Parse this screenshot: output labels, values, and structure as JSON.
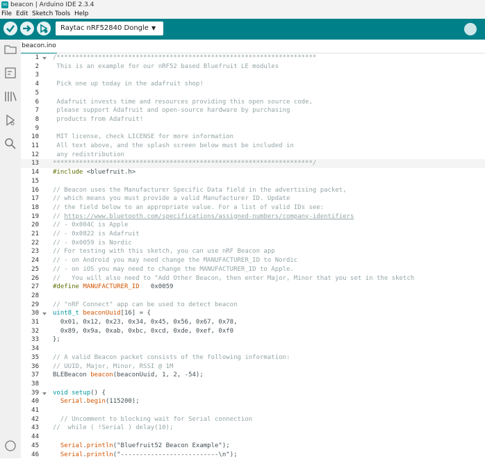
{
  "window": {
    "title": "beacon | Arduino IDE 2.3.4",
    "app_icon_text": "oo"
  },
  "menu": [
    "File",
    "Edit",
    "Sketch",
    "Tools",
    "Help"
  ],
  "toolbar": {
    "board": "Raytac nRF52840 Dongle"
  },
  "tab": {
    "label": "beacon.ino"
  },
  "colors": {
    "toolbar": "#00818a",
    "accent": "#00979d"
  },
  "code": {
    "current_line": 13,
    "lines": [
      {
        "n": "1",
        "parts": [
          {
            "t": "/*********************************************************************",
            "c": "cm"
          }
        ]
      },
      {
        "n": "2",
        "parts": [
          {
            "t": " This is an example for our nRF52 based Bluefruit LE modules",
            "c": "cm"
          }
        ]
      },
      {
        "n": "3",
        "parts": []
      },
      {
        "n": "4",
        "parts": [
          {
            "t": " Pick one up today in the adafruit shop!",
            "c": "cm"
          }
        ]
      },
      {
        "n": "5",
        "parts": []
      },
      {
        "n": "6",
        "parts": [
          {
            "t": " Adafruit invests time and resources providing this open source code,",
            "c": "cm"
          }
        ]
      },
      {
        "n": "7",
        "parts": [
          {
            "t": " please support Adafruit and open-source hardware by purchasing",
            "c": "cm"
          }
        ]
      },
      {
        "n": "8",
        "parts": [
          {
            "t": " products from Adafruit!",
            "c": "cm"
          }
        ]
      },
      {
        "n": "9",
        "parts": []
      },
      {
        "n": "10",
        "parts": [
          {
            "t": " MIT license, check LICENSE for more information",
            "c": "cm"
          }
        ]
      },
      {
        "n": "11",
        "parts": [
          {
            "t": " All text above, and the splash screen below must be included in",
            "c": "cm"
          }
        ]
      },
      {
        "n": "12",
        "parts": [
          {
            "t": " any redistribution",
            "c": "cm"
          }
        ]
      },
      {
        "n": "13",
        "parts": [
          {
            "t": "*********************************************************************/",
            "c": "cm"
          }
        ]
      },
      {
        "n": "14",
        "parts": [
          {
            "t": "#include ",
            "c": "pp"
          },
          {
            "t": "<bluefruit.h>",
            "c": ""
          }
        ]
      },
      {
        "n": "15",
        "parts": []
      },
      {
        "n": "16",
        "parts": [
          {
            "t": "// Beacon uses the Manufacturer Specific Data field in the advertising packet,",
            "c": "cm"
          }
        ]
      },
      {
        "n": "17",
        "parts": [
          {
            "t": "// which means you must provide a valid Manufacturer ID. Update",
            "c": "cm"
          }
        ]
      },
      {
        "n": "18",
        "parts": [
          {
            "t": "// the field below to an appropriate value. For a list of valid IDs see:",
            "c": "cm"
          }
        ]
      },
      {
        "n": "19",
        "parts": [
          {
            "t": "// ",
            "c": "cm"
          },
          {
            "t": "https://www.bluetooth.com/specifications/assigned-numbers/company-identifiers",
            "c": "url"
          }
        ]
      },
      {
        "n": "20",
        "parts": [
          {
            "t": "// - 0x004C is Apple",
            "c": "cm"
          }
        ]
      },
      {
        "n": "21",
        "parts": [
          {
            "t": "// - 0x0822 is Adafruit",
            "c": "cm"
          }
        ]
      },
      {
        "n": "22",
        "parts": [
          {
            "t": "// - 0x0059 is Nordic",
            "c": "cm"
          }
        ]
      },
      {
        "n": "23",
        "parts": [
          {
            "t": "// For testing with this sketch, you can use nRF Beacon app",
            "c": "cm"
          }
        ]
      },
      {
        "n": "24",
        "parts": [
          {
            "t": "// - on Android you may need change the MANUFACTURER_ID to Nordic",
            "c": "cm"
          }
        ]
      },
      {
        "n": "25",
        "parts": [
          {
            "t": "// - on iOS you may need to change the MANUFACTURER_ID to Apple.",
            "c": "cm"
          }
        ]
      },
      {
        "n": "26",
        "parts": [
          {
            "t": "//   You will also need to \"Add Other Beacon, then enter Major, Minor that you set in the sketch",
            "c": "cm"
          }
        ]
      },
      {
        "n": "27",
        "parts": [
          {
            "t": "#define ",
            "c": "pp"
          },
          {
            "t": "MANUFACTURER_ID",
            "c": "fn"
          },
          {
            "t": "   0x0059",
            "c": ""
          }
        ]
      },
      {
        "n": "28",
        "parts": []
      },
      {
        "n": "29",
        "parts": [
          {
            "t": "// \"nRF Connect\" app can be used to detect beacon",
            "c": "cm"
          }
        ]
      },
      {
        "n": "30",
        "parts": [
          {
            "t": "uint8_t ",
            "c": "kw"
          },
          {
            "t": "beaconUuid",
            "c": "fn"
          },
          {
            "t": "[16] = {",
            "c": ""
          }
        ]
      },
      {
        "n": "31",
        "parts": [
          {
            "t": "  0x01, 0x12, 0x23, 0x34, 0x45, 0x56, 0x67, 0x78,",
            "c": ""
          }
        ]
      },
      {
        "n": "32",
        "parts": [
          {
            "t": "  0x89, 0x9a, 0xab, 0xbc, 0xcd, 0xde, 0xef, 0xf0",
            "c": ""
          }
        ]
      },
      {
        "n": "33",
        "parts": [
          {
            "t": "};",
            "c": ""
          }
        ]
      },
      {
        "n": "34",
        "parts": []
      },
      {
        "n": "35",
        "parts": [
          {
            "t": "// A valid Beacon packet consists of the following information:",
            "c": "cm"
          }
        ]
      },
      {
        "n": "36",
        "parts": [
          {
            "t": "// UUID, Major, Minor, RSSI @ 1M",
            "c": "cm"
          }
        ]
      },
      {
        "n": "37",
        "parts": [
          {
            "t": "BLEBeacon ",
            "c": ""
          },
          {
            "t": "beacon",
            "c": "fn"
          },
          {
            "t": "(beaconUuid, 1, 2, -54);",
            "c": ""
          }
        ]
      },
      {
        "n": "38",
        "parts": []
      },
      {
        "n": "39",
        "parts": [
          {
            "t": "void ",
            "c": "kw"
          },
          {
            "t": "setup",
            "c": "kw"
          },
          {
            "t": "() {",
            "c": ""
          }
        ]
      },
      {
        "n": "40",
        "parts": [
          {
            "t": "  ",
            "c": ""
          },
          {
            "t": "Serial",
            "c": "fn"
          },
          {
            "t": ".",
            "c": ""
          },
          {
            "t": "begin",
            "c": "fn"
          },
          {
            "t": "(115200);",
            "c": ""
          }
        ]
      },
      {
        "n": "41",
        "parts": []
      },
      {
        "n": "42",
        "parts": [
          {
            "t": "  // Uncomment to blocking wait for Serial connection",
            "c": "cm"
          }
        ]
      },
      {
        "n": "43",
        "parts": [
          {
            "t": "//  while ( !Serial ) delay(10);",
            "c": "cm"
          }
        ]
      },
      {
        "n": "44",
        "parts": []
      },
      {
        "n": "45",
        "parts": [
          {
            "t": "  ",
            "c": ""
          },
          {
            "t": "Serial",
            "c": "fn"
          },
          {
            "t": ".",
            "c": ""
          },
          {
            "t": "println",
            "c": "fn"
          },
          {
            "t": "(\"Bluefruit52 Beacon Example\");",
            "c": ""
          }
        ]
      },
      {
        "n": "46",
        "parts": [
          {
            "t": "  ",
            "c": ""
          },
          {
            "t": "Serial",
            "c": "fn"
          },
          {
            "t": ".",
            "c": ""
          },
          {
            "t": "println",
            "c": "fn"
          },
          {
            "t": "(\"--------------------------\\n\");",
            "c": ""
          }
        ]
      }
    ]
  }
}
